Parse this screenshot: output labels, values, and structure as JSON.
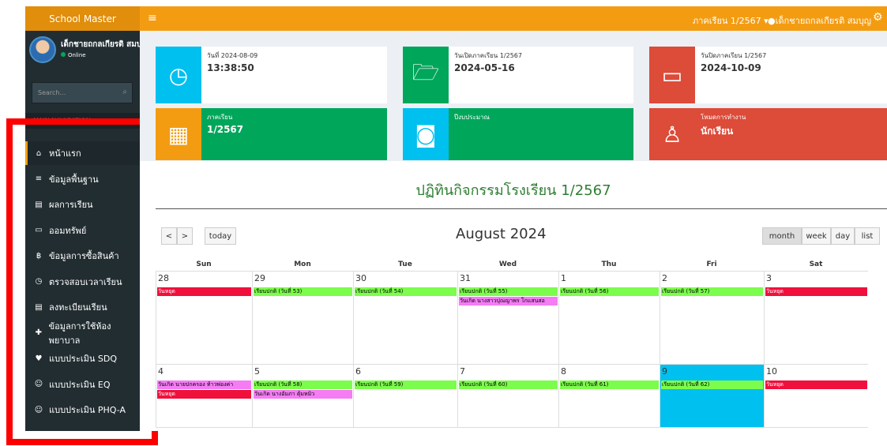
{
  "app": {
    "logo": "School Master"
  },
  "topbar": {
    "menu_icon": "bars-icon",
    "semester": "ภาคเรียน 1/2567 ▾",
    "user": "เด็กชายถกลเกียรติ สมบุญ",
    "settings_icon": "cogs-icon"
  },
  "sidebar": {
    "user_name": "เด็กชายถกลเกียรติ สมบุญ",
    "status": "Online",
    "search_placeholder": "Search...",
    "section_header": "MAIN NAVIGATION",
    "items": [
      {
        "label": "หน้าแรก",
        "icon": "home-icon",
        "glyph": "⌂"
      },
      {
        "label": "ข้อมูลพื้นฐาน",
        "icon": "database-icon",
        "glyph": "≡"
      },
      {
        "label": "ผลการเรียน",
        "icon": "file-icon",
        "glyph": "▤"
      },
      {
        "label": "ออมทรัพย์",
        "icon": "card-icon",
        "glyph": "▭"
      },
      {
        "label": "ข้อมูลการซื้อสินค้า",
        "icon": "baht-icon",
        "glyph": "฿"
      },
      {
        "label": "ตรวจสอบเวลาเรียน",
        "icon": "clock-icon",
        "glyph": "◷"
      },
      {
        "label": "ลงทะเบียนเรียน",
        "icon": "file-text-icon",
        "glyph": "▤"
      },
      {
        "label": "ข้อมูลการใช้ห้องพยาบาล",
        "icon": "medkit-icon",
        "glyph": "✚"
      },
      {
        "label": "แบบประเมิน SDQ",
        "icon": "heart-icon",
        "glyph": "♥"
      },
      {
        "label": "แบบประเมิน EQ",
        "icon": "smile-icon",
        "glyph": "☺"
      },
      {
        "label": "แบบประเมิน PHQ-A",
        "icon": "smile-icon",
        "glyph": "☺"
      }
    ]
  },
  "info": {
    "date_label": "วันที่ 2024-08-09",
    "time": "13:38:50",
    "open_label": "วันเปิดภาคเรียน 1/2567",
    "open_date": "2024-05-16",
    "close_label": "วันปิดภาคเรียน 1/2567",
    "close_date": "2024-10-09",
    "sem_label": "ภาคเรียน",
    "sem_value": "1/2567",
    "budget_label": "ปีงบประมาณ",
    "budget_value": "",
    "mode_label": "โหมดการทำงาน",
    "mode_value": "นักเรียน"
  },
  "calendar": {
    "title": "ปฏิทินกิจกรรมโรงเรียน 1/2567",
    "month": "August 2024",
    "today_btn": "today",
    "prev": "<",
    "next": ">",
    "views": [
      "month",
      "week",
      "day",
      "list"
    ],
    "dows": [
      "Sun",
      "Mon",
      "Tue",
      "Wed",
      "Thu",
      "Fri",
      "Sat"
    ],
    "week1": [
      "28",
      "29",
      "30",
      "31",
      "1",
      "2",
      "3"
    ],
    "week2": [
      "4",
      "5",
      "6",
      "7",
      "8",
      "9",
      "10"
    ],
    "ev": {
      "w1d0": "วันหยุด",
      "w1d1": "เรียนปกติ (วันที่ 53)",
      "w1d2": "เรียนปกติ (วันที่ 54)",
      "w1d3a": "เรียนปกติ (วันที่ 55)",
      "w1d3b": "วันเกิด นางสาวปุณญาพร โกแสนสอ",
      "w1d4": "เรียนปกติ (วันที่ 56)",
      "w1d5": "เรียนปกติ (วันที่ 57)",
      "w1d6": "วันหยุด",
      "w2d0a": "วันเกิด นายปกครอง ท้าวพ่องค่า",
      "w2d0b": "วันหยุด",
      "w2d1a": "เรียนปกติ (วันที่ 58)",
      "w2d1b": "วันเกิด นางอัมภา ตุ้มหมิว",
      "w2d2": "เรียนปกติ (วันที่ 59)",
      "w2d3": "เรียนปกติ (วันที่ 60)",
      "w2d4": "เรียนปกติ (วันที่ 61)",
      "w2d5": "เรียนปกติ (วันที่ 62)",
      "w2d6": "วันหยุด"
    }
  },
  "colors": {
    "orange": "#f39c12",
    "blue": "#00c0ef",
    "green": "#00a65a",
    "red": "#dd4b39",
    "sidebar": "#222d32"
  }
}
